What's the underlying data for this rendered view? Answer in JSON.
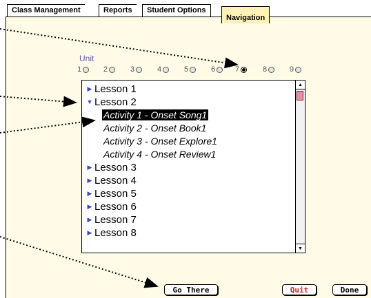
{
  "tabs": [
    {
      "label": "Class Management"
    },
    {
      "label": "Reports"
    },
    {
      "label": "Student Options"
    },
    {
      "label": "Navigation",
      "active": true
    }
  ],
  "unit": {
    "label": "Unit",
    "options": [
      "1",
      "2",
      "3",
      "4",
      "5",
      "6",
      "7",
      "8",
      "9"
    ],
    "selected": "7"
  },
  "list": {
    "lessons_top": [
      {
        "label": "Lesson 1",
        "expanded": false
      },
      {
        "label": "Lesson 2",
        "expanded": true
      }
    ],
    "activities": [
      {
        "label": "Activity 1 - Onset Song1",
        "selected": true
      },
      {
        "label": "Activity 2 - Onset Book1",
        "selected": false
      },
      {
        "label": "Activity 3 - Onset Explore1",
        "selected": false
      },
      {
        "label": "Activity 4 - Onset Review1",
        "selected": false
      }
    ],
    "lessons_bottom": [
      {
        "label": "Lesson 3"
      },
      {
        "label": "Lesson 4"
      },
      {
        "label": "Lesson 5"
      },
      {
        "label": "Lesson 6"
      },
      {
        "label": "Lesson 7"
      },
      {
        "label": "Lesson 8"
      }
    ]
  },
  "buttons": {
    "go_there": "Go There",
    "quit": "Quit",
    "done": "Done"
  },
  "colors": {
    "panel_bg": "#fffbe7",
    "active_tab": "#fff1b8",
    "disclosure": "#3b48c2",
    "unit_label": "#5e5ea0",
    "scroll_thumb": "#e98ea4",
    "quit_text": "#c2272d"
  }
}
